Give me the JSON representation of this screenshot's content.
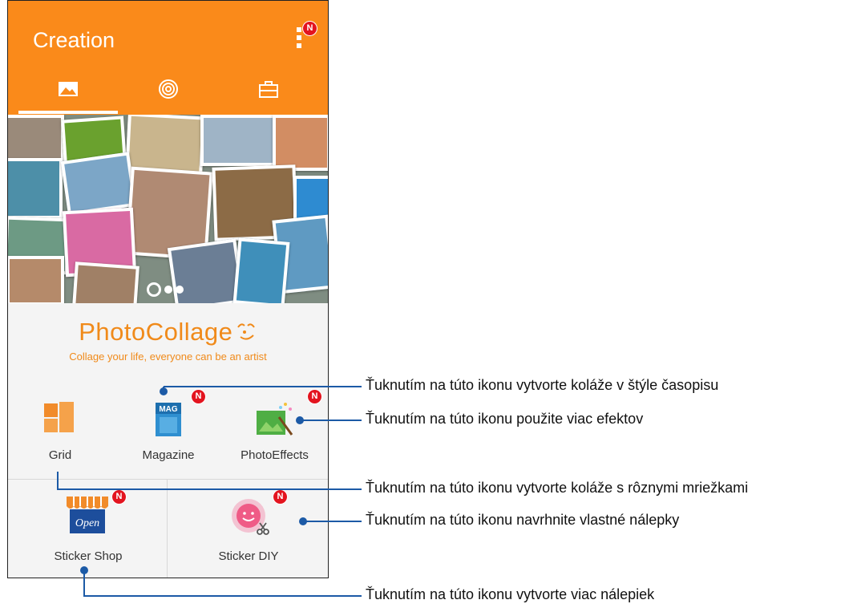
{
  "app": {
    "title": "Creation",
    "overflow_badge": "N",
    "tabs": [
      {
        "icon": "image-icon",
        "selected": true
      },
      {
        "icon": "target-icon",
        "selected": false
      },
      {
        "icon": "briefcase-icon",
        "selected": false
      }
    ]
  },
  "banner": {
    "logo_text": "PhotoCollage",
    "tagline": "Collage your life, everyone can be an artist",
    "pager": {
      "pages": 3,
      "current": 1
    }
  },
  "features": {
    "grid": {
      "label": "Grid",
      "badge": ""
    },
    "magazine": {
      "label": "Magazine",
      "badge": "N",
      "icon_text": "MAG"
    },
    "photoeffects": {
      "label": "PhotoEffects",
      "badge": "N"
    },
    "sticker_shop": {
      "label": "Sticker Shop",
      "badge": "N",
      "icon_text": "Open"
    },
    "sticker_diy": {
      "label": "Sticker DIY",
      "badge": "N"
    }
  },
  "callouts": {
    "magazine": "Ťuknutím na túto ikonu vytvorte koláže v štýle časopisu",
    "effects": "Ťuknutím na túto ikonu použite viac efektov",
    "grid": "Ťuknutím na túto ikonu vytvorte koláže s rôznymi mriežkami",
    "diy": "Ťuknutím na túto ikonu navrhnite vlastné nálepky",
    "shop": "Ťuknutím na túto ikonu vytvorte viac nálepiek"
  },
  "colors": {
    "accent": "#fa8a1a",
    "badge": "#e3141f",
    "callout_line": "#1c5aa6"
  }
}
